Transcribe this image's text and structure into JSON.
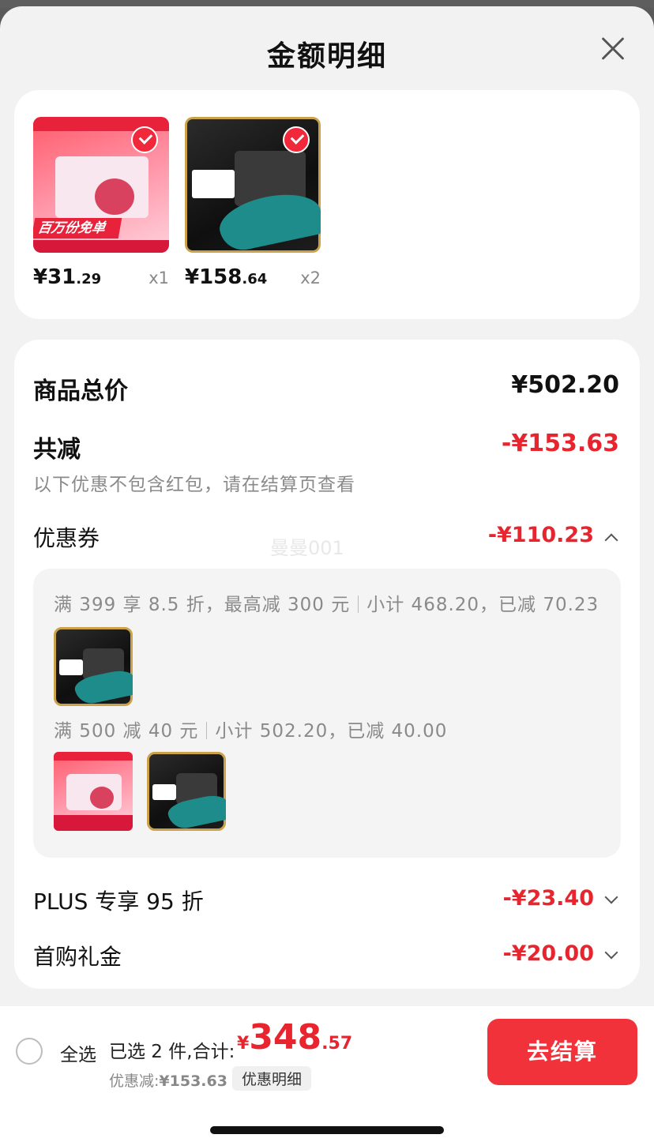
{
  "sheet": {
    "title": "金额明细"
  },
  "products": [
    {
      "price_int": "¥31",
      "price_dec": ".29",
      "qty": "x1",
      "checked": true,
      "banner_text": "百万份免单"
    },
    {
      "price_int": "¥158",
      "price_dec": ".64",
      "qty": "x2",
      "checked": true
    }
  ],
  "summary": {
    "total_label": "商品总价",
    "total_value": "¥502.20",
    "reduce_label": "共减",
    "reduce_value": "-¥153.63",
    "note": "以下优惠不包含红包，请在结算页查看",
    "watermark": "曼曼001"
  },
  "coupon": {
    "label": "优惠券",
    "value": "-¥110.23",
    "rules": [
      {
        "condition": "满 399 享 8.5 折，最高减 300 元",
        "subtotal": "小计 468.20，已减 70.23"
      },
      {
        "condition": "满 500 减 40 元",
        "subtotal": "小计 502.20，已减 40.00"
      }
    ]
  },
  "plus": {
    "label": "PLUS 专享 95 折",
    "value": "-¥23.40"
  },
  "first_buy": {
    "label": "首购礼金",
    "value": "-¥20.00"
  },
  "bottom": {
    "select_all": "全选",
    "selected_text": "已选 2 件,合计:",
    "total_yen": "¥",
    "total_int": "348",
    "total_dec": ".57",
    "discount_label": "优惠减:",
    "discount_value": "¥153.63",
    "detail_button": "优惠明细",
    "checkout_button": "去结算"
  },
  "colors": {
    "accent_red": "#e8242e",
    "button_red": "#f2323a",
    "sheet_bg": "#f2f2f2"
  },
  "icons": {
    "close": "close-icon",
    "check": "check-icon",
    "expand_up": "chevron-up-icon",
    "expand_down": "chevron-down-icon"
  }
}
